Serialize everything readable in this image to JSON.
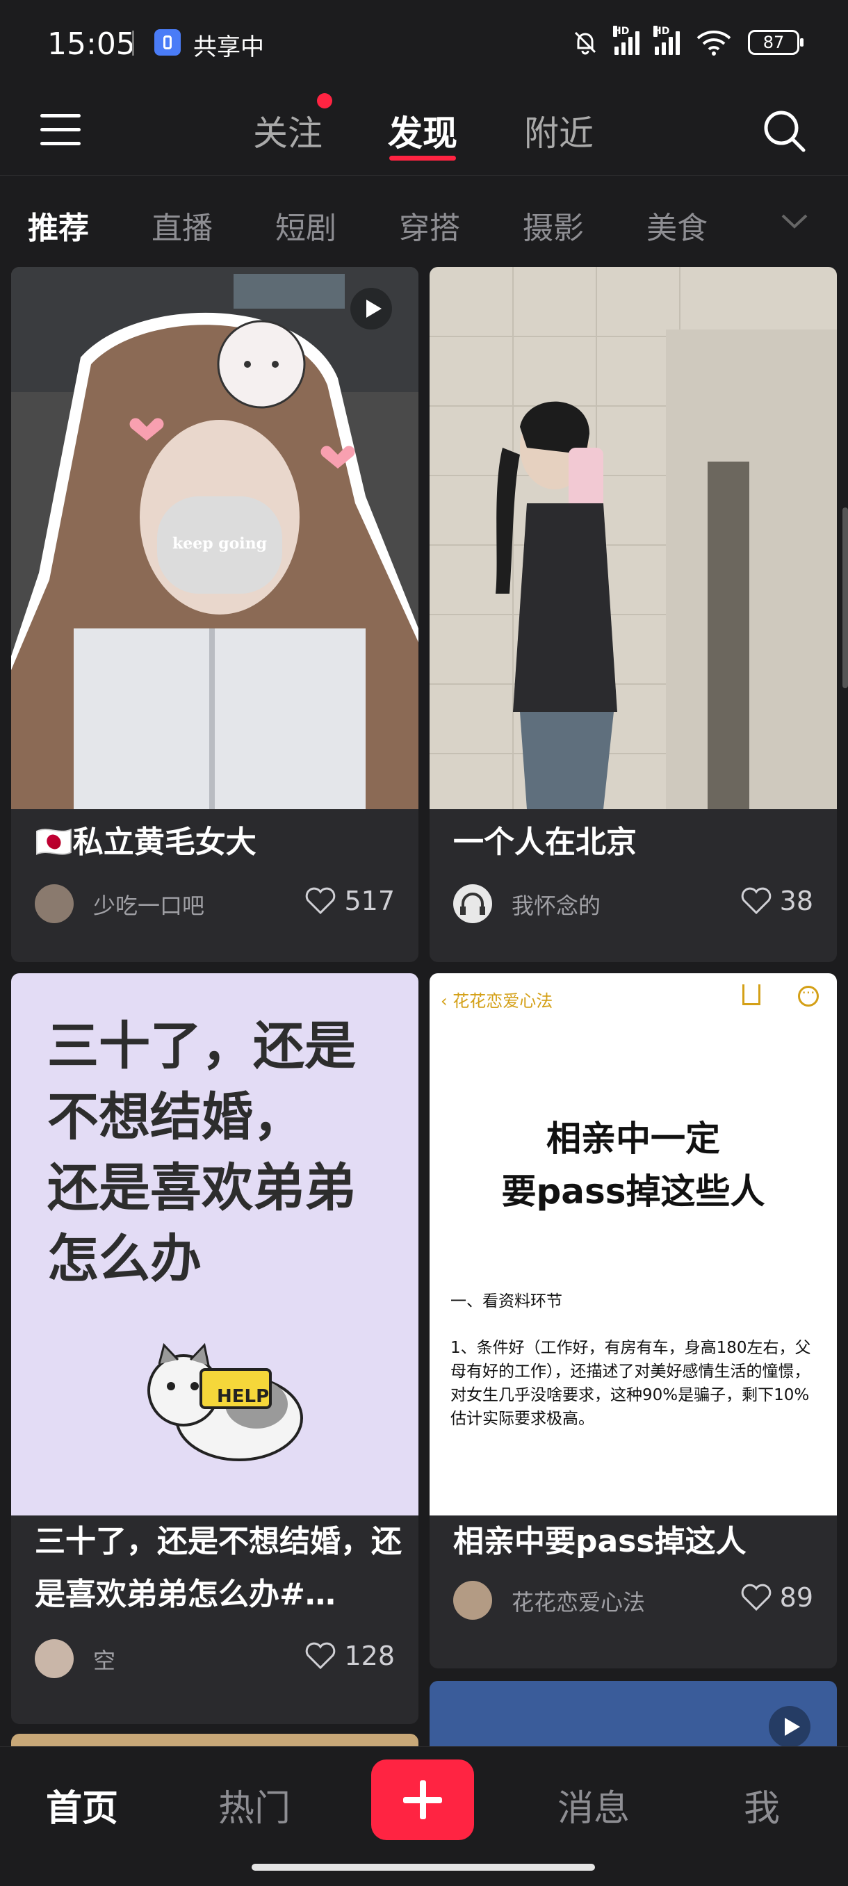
{
  "status_bar": {
    "time": "15:05",
    "sharing_label": "共享中",
    "signal_1_label": "HD",
    "signal_2_label": "HD",
    "battery": "87"
  },
  "top_nav": {
    "tabs": [
      {
        "label": "关注",
        "has_notification_dot": true
      },
      {
        "label": "发现",
        "active": true
      },
      {
        "label": "附近"
      }
    ]
  },
  "categories": [
    "推荐",
    "直播",
    "短剧",
    "穿搭",
    "摄影",
    "美食"
  ],
  "feed": [
    {
      "title": "🇯🇵私立黄毛女大",
      "image_overlay_text": "keep going",
      "is_video": true,
      "author": "少吃一口吧",
      "likes": "517"
    },
    {
      "title": "一个人在北京",
      "is_video": false,
      "author": "我怀念的",
      "likes": "38"
    },
    {
      "title": "三十了，还是不想结婚，还是喜欢弟弟怎么办#…",
      "image_text": [
        "三十了，还是",
        "不想结婚，",
        "还是喜欢弟弟",
        "怎么办"
      ],
      "image_sign": "HELP",
      "author": "空",
      "likes": "128"
    },
    {
      "title": "相亲中要pass掉这人",
      "image_header": "花花恋爱心法",
      "image_heading": [
        "相亲中一定",
        "要pass掉这些人"
      ],
      "image_section": "一、看资料环节",
      "image_body": "1、条件好（工作好，有房有车，身高180左右，父母有好的工作），还描述了对美好感情生活的憧憬，对女生几乎没啥要求，这种90%是骗子，剩下10%估计实际要求极高。",
      "author": "花花恋爱心法",
      "likes": "89"
    }
  ],
  "bottom_nav": {
    "items": [
      "首页",
      "热门",
      "消息",
      "我"
    ],
    "active": "首页"
  },
  "colors": {
    "background": "#1c1c1e",
    "card": "#2a2a2d",
    "accent": "#ff2442",
    "muted_text": "#8e8e93"
  }
}
